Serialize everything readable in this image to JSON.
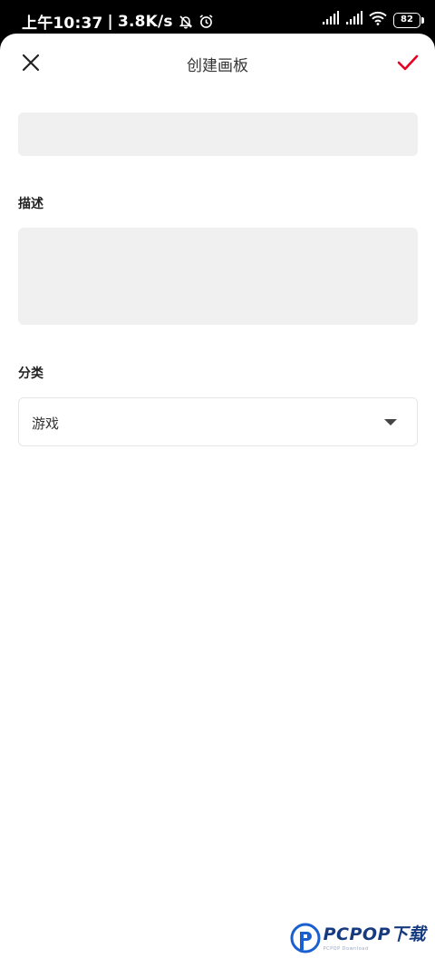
{
  "status_bar": {
    "time": "上午10:37",
    "speed": "3.8K/s",
    "battery": "82",
    "icons": [
      "bell-off-icon",
      "alarm-icon",
      "signal-icon",
      "signal-icon",
      "wifi-icon",
      "battery-icon"
    ]
  },
  "header": {
    "title": "创建画板",
    "close_icon": "close-icon",
    "confirm_icon": "check-icon",
    "accent_color": "#e60023"
  },
  "form": {
    "name": {
      "value": "",
      "placeholder": ""
    },
    "description": {
      "label": "描述",
      "value": "",
      "placeholder": ""
    },
    "category": {
      "label": "分类",
      "selected": "游戏"
    }
  },
  "watermark": {
    "text": "PCPOP下载",
    "sub": "PCPOP Download"
  }
}
